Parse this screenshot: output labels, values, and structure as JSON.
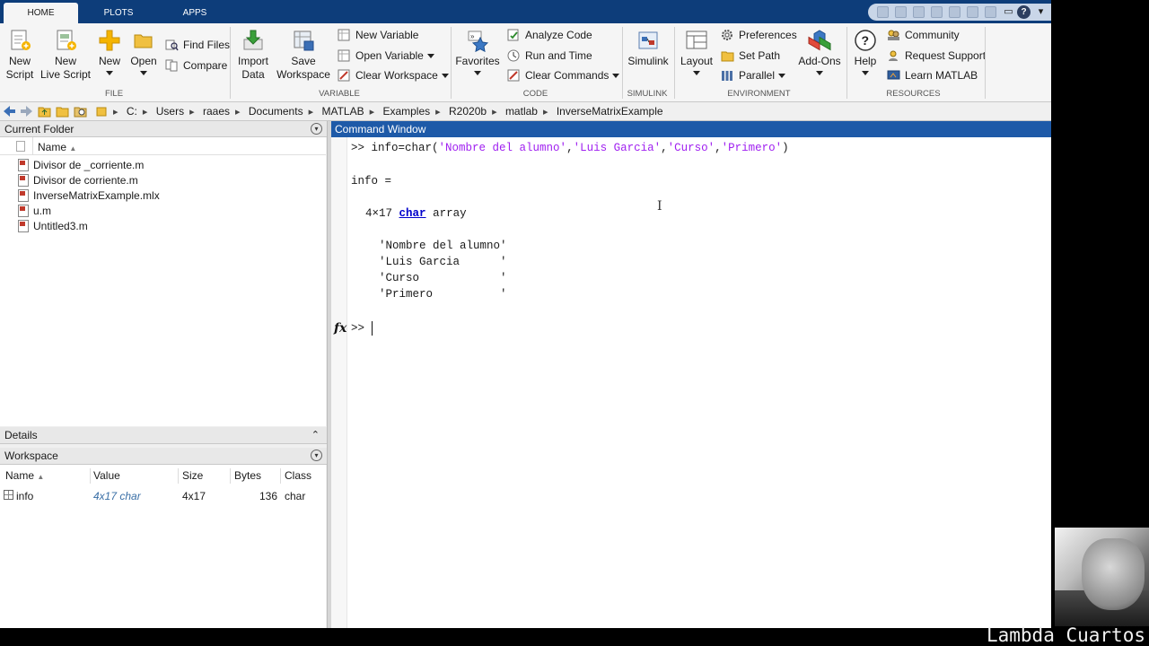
{
  "tabs": [
    "HOME",
    "PLOTS",
    "APPS"
  ],
  "toolstrip": {
    "file": {
      "label": "FILE",
      "new_script": "New\nScript",
      "new_live_script": "New\nLive Script",
      "new": "New",
      "open": "Open",
      "find_files": "Find Files",
      "compare": "Compare"
    },
    "variable": {
      "label": "VARIABLE",
      "import_data": "Import\nData",
      "save_workspace": "Save\nWorkspace",
      "new_variable": "New Variable",
      "open_variable": "Open Variable",
      "clear_workspace": "Clear Workspace"
    },
    "code": {
      "label": "CODE",
      "favorites": "Favorites",
      "analyze_code": "Analyze Code",
      "run_and_time": "Run and Time",
      "clear_commands": "Clear Commands"
    },
    "simulink": {
      "label": "SIMULINK",
      "simulink": "Simulink"
    },
    "environment": {
      "label": "ENVIRONMENT",
      "layout": "Layout",
      "preferences": "Preferences",
      "set_path": "Set Path",
      "parallel": "Parallel",
      "add_ons": "Add-Ons"
    },
    "resources": {
      "label": "RESOURCES",
      "help": "Help",
      "community": "Community",
      "request_support": "Request Support",
      "learn_matlab": "Learn MATLAB"
    }
  },
  "breadcrumbs": [
    "C:",
    "Users",
    "raaes",
    "Documents",
    "MATLAB",
    "Examples",
    "R2020b",
    "matlab",
    "InverseMatrixExample"
  ],
  "current_folder": {
    "title": "Current Folder",
    "name_header": "Name",
    "files": [
      "Divisor de _corriente.m",
      "Divisor de corriente.m",
      "InverseMatrixExample.mlx",
      "u.m",
      "Untitled3.m"
    ]
  },
  "details": {
    "title": "Details"
  },
  "workspace": {
    "title": "Workspace",
    "headers": {
      "name": "Name",
      "value": "Value",
      "size": "Size",
      "bytes": "Bytes",
      "class": "Class"
    },
    "rows": [
      {
        "name": "info",
        "value": "4x17 char",
        "size": "4x17",
        "bytes": "136",
        "class": "char"
      }
    ]
  },
  "command_window": {
    "title": "Command Window",
    "cmd_prompt": ">> ",
    "cmd_func": "info=char(",
    "cmd_args": [
      "'Nombre del alumno'",
      "'Luis Garcia'",
      "'Curso'",
      "'Primero'"
    ],
    "cmd_comma": ",",
    "cmd_close": ")",
    "var_line": "info =",
    "dims": "4×17",
    "type_kw": "char",
    "type_word": "array",
    "rows": [
      "'Nombre del alumno'",
      "'Luis Garcia      '",
      "'Curso            '",
      "'Primero          '"
    ],
    "fx_label": "fx",
    "final_prompt": ">>"
  },
  "watermark": "Lambda Cuartos"
}
